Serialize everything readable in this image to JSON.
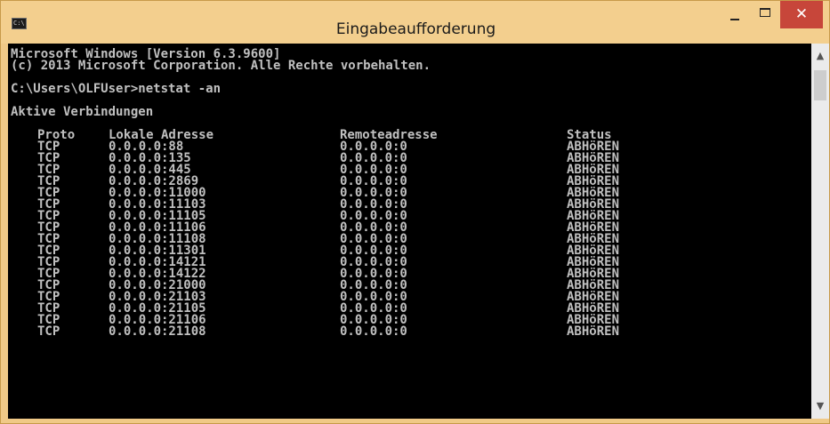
{
  "window": {
    "title": "Eingabeaufforderung",
    "icon_label": "C:\\",
    "controls": {
      "minimize": "–",
      "maximize": "□",
      "close": "✕"
    }
  },
  "console": {
    "lines": [
      "Microsoft Windows [Version 6.3.9600]",
      "(c) 2013 Microsoft Corporation. Alle Rechte vorbehalten.",
      "",
      "C:\\Users\\OLFUser>netstat -an",
      "",
      "Aktive Verbindungen",
      ""
    ],
    "table": {
      "headers": {
        "proto": "Proto",
        "local": "Lokale Adresse",
        "remote": "Remoteadresse",
        "status": "Status"
      },
      "rows": [
        {
          "proto": "TCP",
          "local": "0.0.0.0:88",
          "remote": "0.0.0.0:0",
          "status": "ABHöREN"
        },
        {
          "proto": "TCP",
          "local": "0.0.0.0:135",
          "remote": "0.0.0.0:0",
          "status": "ABHöREN"
        },
        {
          "proto": "TCP",
          "local": "0.0.0.0:445",
          "remote": "0.0.0.0:0",
          "status": "ABHöREN"
        },
        {
          "proto": "TCP",
          "local": "0.0.0.0:2869",
          "remote": "0.0.0.0:0",
          "status": "ABHöREN"
        },
        {
          "proto": "TCP",
          "local": "0.0.0.0:11000",
          "remote": "0.0.0.0:0",
          "status": "ABHöREN"
        },
        {
          "proto": "TCP",
          "local": "0.0.0.0:11103",
          "remote": "0.0.0.0:0",
          "status": "ABHöREN"
        },
        {
          "proto": "TCP",
          "local": "0.0.0.0:11105",
          "remote": "0.0.0.0:0",
          "status": "ABHöREN"
        },
        {
          "proto": "TCP",
          "local": "0.0.0.0:11106",
          "remote": "0.0.0.0:0",
          "status": "ABHöREN"
        },
        {
          "proto": "TCP",
          "local": "0.0.0.0:11108",
          "remote": "0.0.0.0:0",
          "status": "ABHöREN"
        },
        {
          "proto": "TCP",
          "local": "0.0.0.0:11301",
          "remote": "0.0.0.0:0",
          "status": "ABHöREN"
        },
        {
          "proto": "TCP",
          "local": "0.0.0.0:14121",
          "remote": "0.0.0.0:0",
          "status": "ABHöREN"
        },
        {
          "proto": "TCP",
          "local": "0.0.0.0:14122",
          "remote": "0.0.0.0:0",
          "status": "ABHöREN"
        },
        {
          "proto": "TCP",
          "local": "0.0.0.0:21000",
          "remote": "0.0.0.0:0",
          "status": "ABHöREN"
        },
        {
          "proto": "TCP",
          "local": "0.0.0.0:21103",
          "remote": "0.0.0.0:0",
          "status": "ABHöREN"
        },
        {
          "proto": "TCP",
          "local": "0.0.0.0:21105",
          "remote": "0.0.0.0:0",
          "status": "ABHöREN"
        },
        {
          "proto": "TCP",
          "local": "0.0.0.0:21106",
          "remote": "0.0.0.0:0",
          "status": "ABHöREN"
        },
        {
          "proto": "TCP",
          "local": "0.0.0.0:21108",
          "remote": "0.0.0.0:0",
          "status": "ABHöREN"
        }
      ]
    }
  },
  "scrollbar": {
    "up_arrow": "▲",
    "down_arrow": "▼"
  },
  "colors": {
    "title_bar": "#f3cf8e",
    "console_background": "#000000",
    "console_text": "#c0c0c0",
    "close_button": "#c7463a"
  }
}
